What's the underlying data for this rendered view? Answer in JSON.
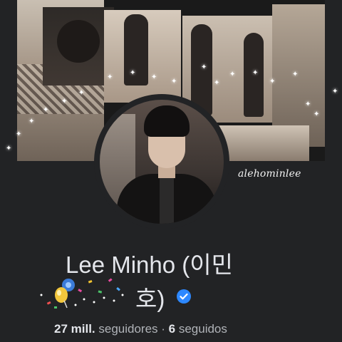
{
  "profile": {
    "name_line1": "Lee Minho (이민",
    "name_line2": "호)",
    "verified_icon": "verified-badge-icon",
    "accent_color": "#2d88ff"
  },
  "stats": {
    "followers_count": "27 mill.",
    "followers_label": " seguidores · ",
    "following_count": "6",
    "following_label": " seguidos"
  },
  "watermark": "alehominlee",
  "icons": {
    "sparkles": "sparkle-icon",
    "confetti": "party-confetti-icon"
  }
}
